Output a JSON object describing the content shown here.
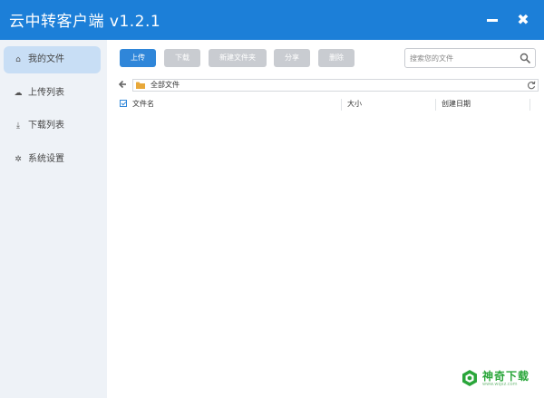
{
  "app": {
    "title": "云中转客户端  v1.2.1"
  },
  "window": {
    "minimize_icon": "minimize-icon",
    "close_icon": "close-icon",
    "close_glyph": "✖"
  },
  "sidebar": {
    "items": [
      {
        "label": "我的文件",
        "icon": "home-icon",
        "glyph": "⌂",
        "active": true
      },
      {
        "label": "上传列表",
        "icon": "cloud-upload-icon",
        "glyph": "☁",
        "active": false
      },
      {
        "label": "下载列表",
        "icon": "download-icon",
        "glyph": "⤓",
        "active": false
      },
      {
        "label": "系统设置",
        "icon": "gear-icon",
        "glyph": "✲",
        "active": false
      }
    ]
  },
  "toolbar": {
    "upload": "上传",
    "download": "下载",
    "new_folder": "新建文件夹",
    "share": "分享",
    "delete": "删除"
  },
  "search": {
    "placeholder": "搜索您的文件",
    "value": ""
  },
  "path": {
    "current": "全部文件"
  },
  "table": {
    "columns": [
      "文件名",
      "大小",
      "创建日期"
    ],
    "select_all_checked": true,
    "rows": []
  },
  "watermark": {
    "text": "神奇下载",
    "url": "www.wqxz.com"
  },
  "colors": {
    "accent": "#1c7fd8",
    "primary_button": "#2f86d9",
    "disabled_button": "#c9ccd1",
    "sidebar_bg": "#eef2f7",
    "sidebar_active": "#c8def5",
    "watermark": "#2aa63a"
  }
}
